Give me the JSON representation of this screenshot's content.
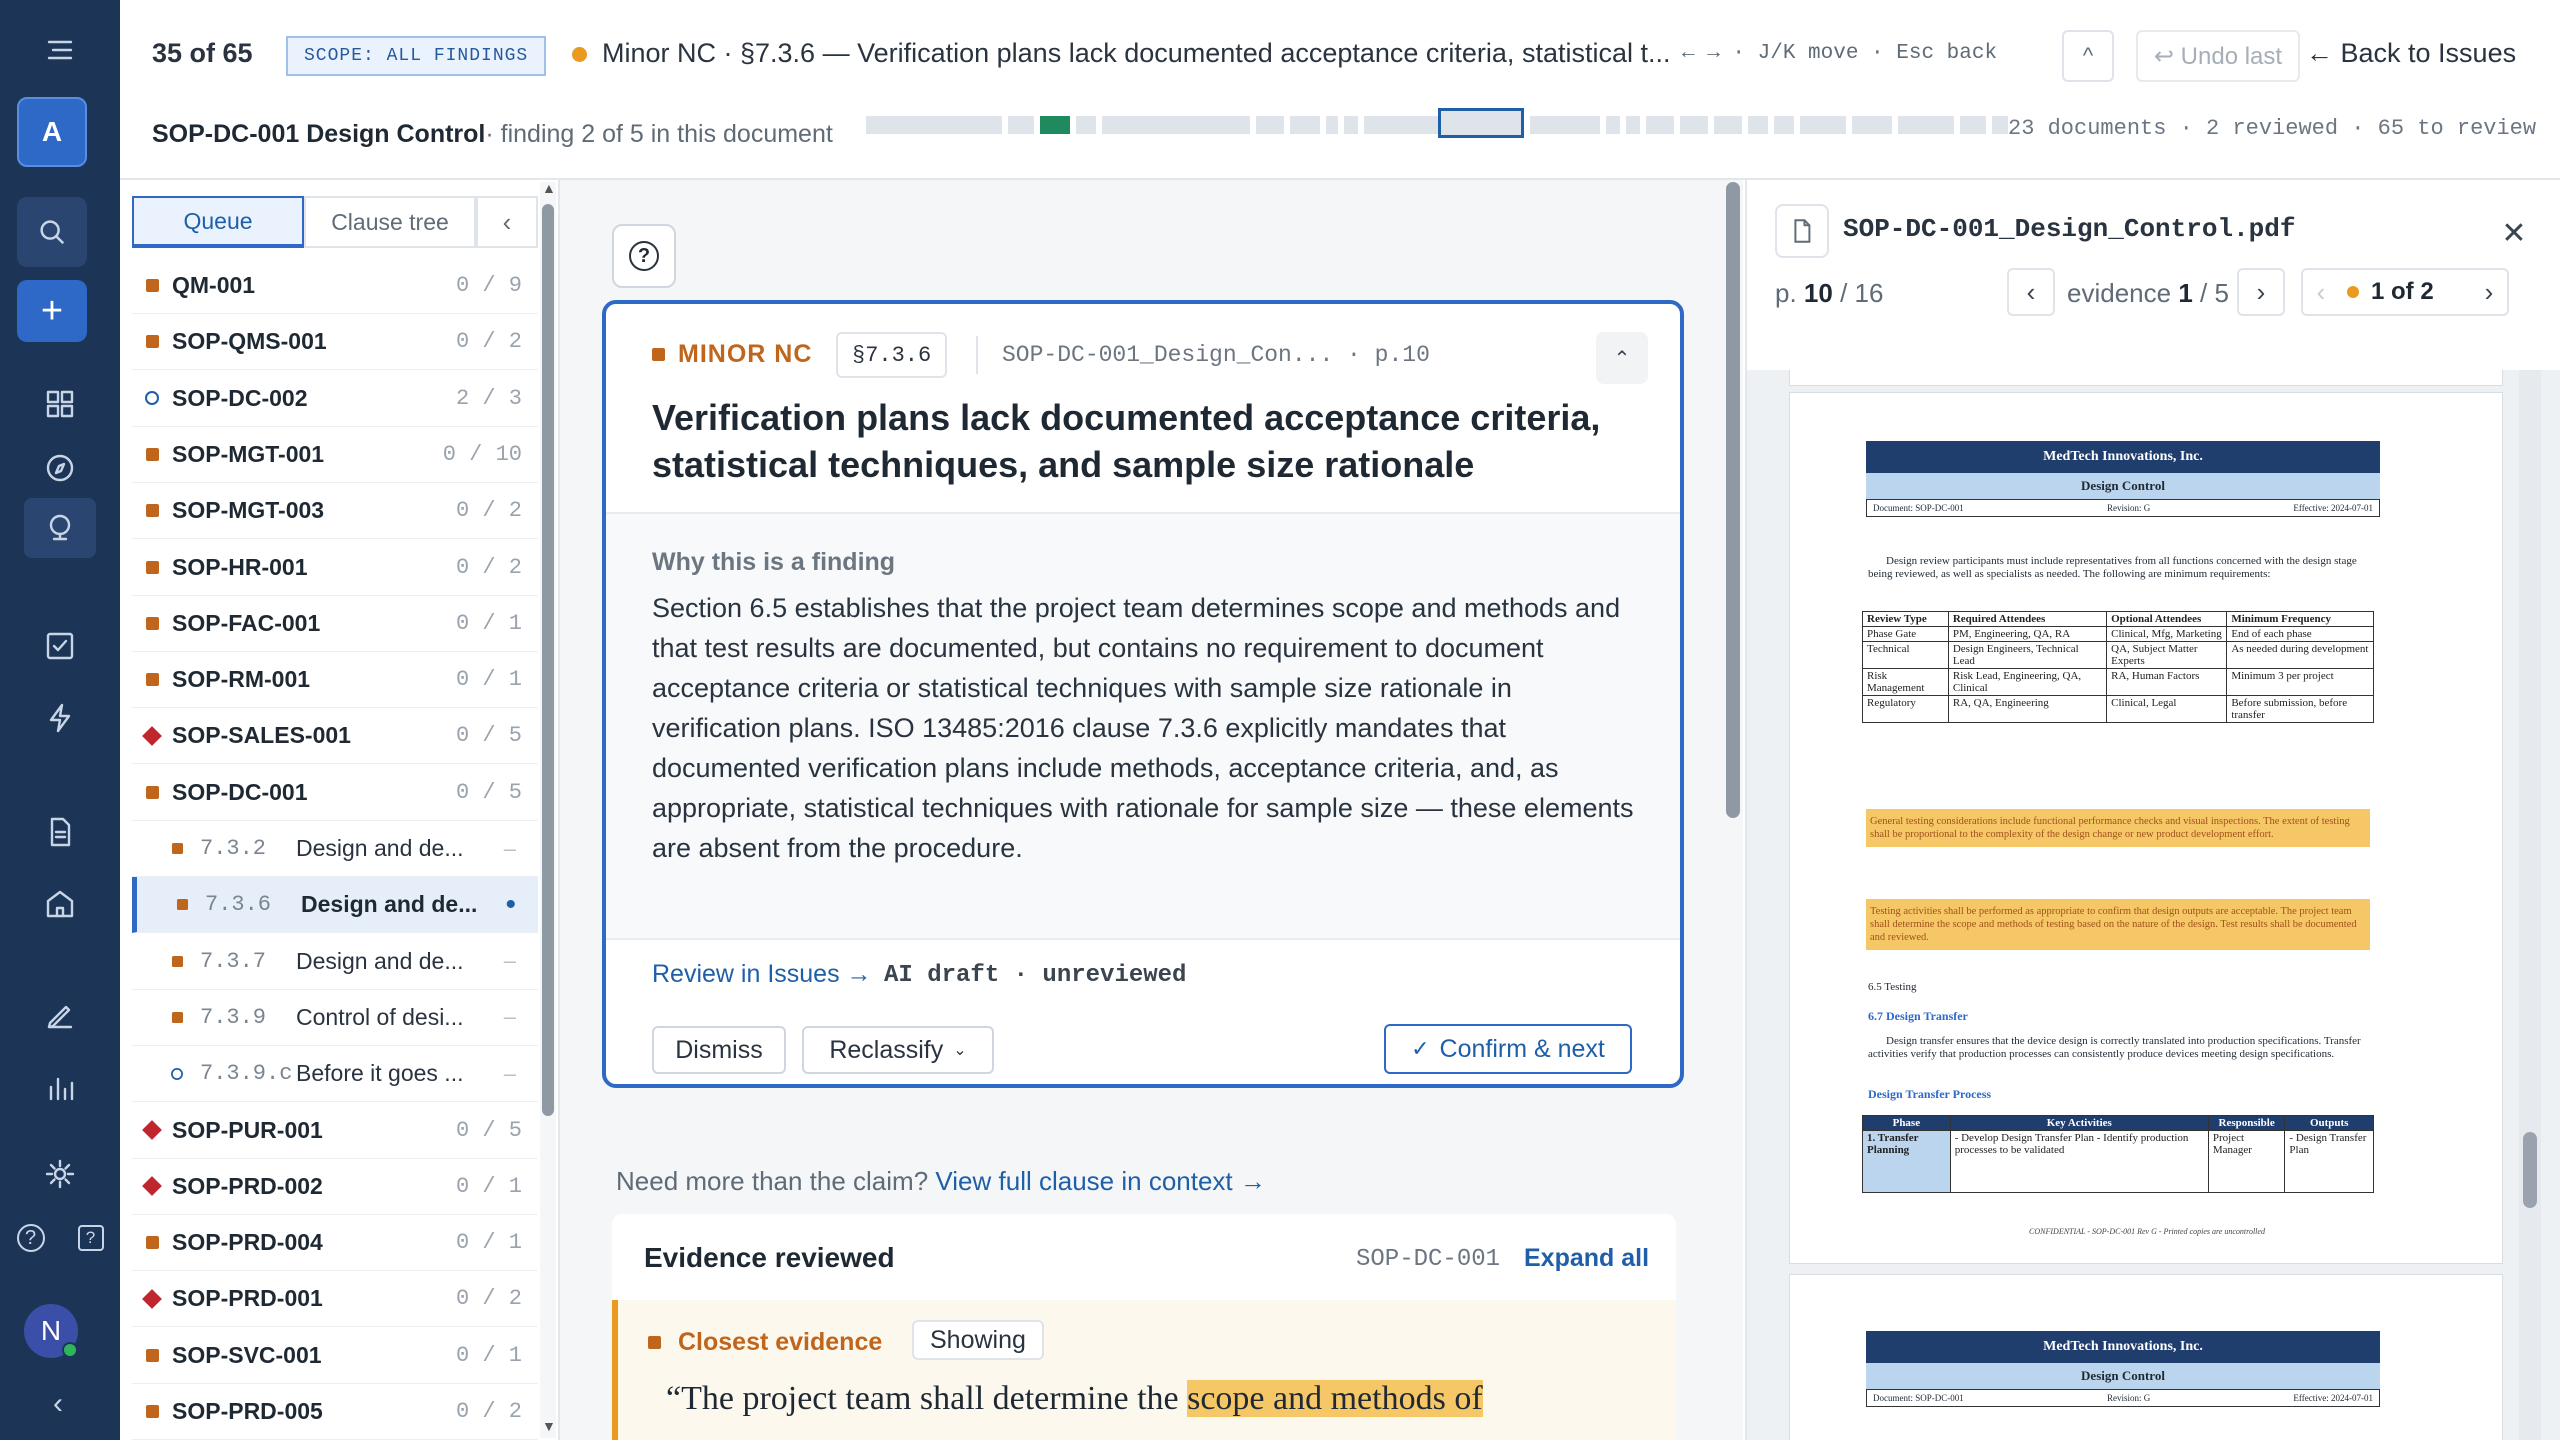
{
  "topbar": {
    "counter": "35 of 65",
    "scope": "SCOPE: ALL FINDINGS",
    "title": "Minor NC · §7.3.6 — Verification plans lack documented acceptance criteria, statistical t...",
    "shortcuts": "← → · J/K move · Esc back",
    "undo": "↩ Undo last",
    "back": "← Back to Issues",
    "doc_name": "SOP-DC-001 Design Control",
    "doc_sub": "· finding 2 of 5 in this document",
    "stats": "23 documents · 2 reviewed · 65 to review",
    "caret": "^"
  },
  "rail": {
    "workspace": "A",
    "avatar": "N",
    "help": "?"
  },
  "queue": {
    "tab_queue": "Queue",
    "tab_tree": "Clause tree",
    "collapse": "‹",
    "items": [
      {
        "name": "QM-001",
        "count": "0 / 9",
        "marker": "sq"
      },
      {
        "name": "SOP-QMS-001",
        "count": "0 / 2",
        "marker": "sq"
      },
      {
        "name": "SOP-DC-002",
        "count": "2 / 3",
        "marker": "circ"
      },
      {
        "name": "SOP-MGT-001",
        "count": "0 / 10",
        "marker": "sq"
      },
      {
        "name": "SOP-MGT-003",
        "count": "0 / 2",
        "marker": "sq"
      },
      {
        "name": "SOP-HR-001",
        "count": "0 / 2",
        "marker": "sq"
      },
      {
        "name": "SOP-FAC-001",
        "count": "0 / 1",
        "marker": "sq"
      },
      {
        "name": "SOP-RM-001",
        "count": "0 / 1",
        "marker": "sq"
      },
      {
        "name": "SOP-SALES-001",
        "count": "0 / 5",
        "marker": "dia"
      },
      {
        "name": "SOP-DC-001",
        "count": "0 / 5",
        "marker": "sq"
      }
    ],
    "sub": [
      {
        "clause": "7.3.2",
        "title": "Design and de...",
        "state": "–"
      },
      {
        "clause": "7.3.6",
        "title": "Design and de...",
        "state": "•"
      },
      {
        "clause": "7.3.7",
        "title": "Design and de...",
        "state": "–"
      },
      {
        "clause": "7.3.9",
        "title": "Control of desi...",
        "state": "–"
      },
      {
        "clause": "7.3.9.c",
        "title": "Before it goes ...",
        "state": "–"
      }
    ],
    "items2": [
      {
        "name": "SOP-PUR-001",
        "count": "0 / 5",
        "marker": "dia"
      },
      {
        "name": "SOP-PRD-002",
        "count": "0 / 1",
        "marker": "dia"
      },
      {
        "name": "SOP-PRD-004",
        "count": "0 / 1",
        "marker": "sq"
      },
      {
        "name": "SOP-PRD-001",
        "count": "0 / 2",
        "marker": "dia"
      },
      {
        "name": "SOP-SVC-001",
        "count": "0 / 1",
        "marker": "sq"
      },
      {
        "name": "SOP-PRD-005",
        "count": "0 / 2",
        "marker": "sq"
      }
    ]
  },
  "finding": {
    "severity": "MINOR NC",
    "clause": "§7.3.6",
    "source": "SOP-DC-001_Design_Con... · p.10",
    "title": "Verification plans lack documented acceptance criteria, statistical techniques, and sample size rationale",
    "why_label": "Why this is a finding",
    "why_text": "Section 6.5 establishes that the project team determines scope and methods and that test results are documented, but contains no requirement to document acceptance criteria or statistical techniques with sample size rationale in verification plans. ISO 13485:2016 clause 7.3.6 explicitly mandates that documented verification plans include methods, acceptance criteria, and, as appropriate, statistical techniques with rationale for sample size — these elements are absent from the procedure.",
    "review_link": "Review in Issues →",
    "ai_status": "AI draft · unreviewed",
    "dismiss": "Dismiss",
    "reclassify": "Reclassify",
    "confirm": "Confirm & next",
    "help": "?"
  },
  "context": {
    "prompt": "Need more than the claim?",
    "link": "View full clause in context →"
  },
  "evidence": {
    "header": "Evidence reviewed",
    "doc": "SOP-DC-001",
    "expand": "Expand all",
    "closest": "Closest evidence",
    "showing": "Showing",
    "quote_pre": "“The project team shall determine the ",
    "quote_hl": "scope and methods of"
  },
  "pdf": {
    "filename": "SOP-DC-001_Design_Control.pdf",
    "page_cur": "10",
    "page_total": "/ 16",
    "page_prefix": "p.",
    "ev_label": "evidence",
    "ev_cur": "1",
    "ev_total": "/ 5",
    "hit": "1 of 2",
    "doc": {
      "company": "MedTech Innovations, Inc.",
      "section": "Design Control",
      "docno": "Document: SOP-DC-001",
      "rev": "Revision: G",
      "eff": "Effective: 2024-07-01",
      "p1": "Design review participants must include representatives from all functions concerned with the design stage being reviewed, as well as specialists as needed. The following are minimum requirements:",
      "th": [
        "Review Type",
        "Required Attendees",
        "Optional Attendees",
        "Minimum Frequency"
      ],
      "rows": [
        [
          "Phase Gate",
          "PM, Engineering, QA, RA",
          "Clinical, Mfg, Marketing",
          "End of each phase"
        ],
        [
          "Technical",
          "Design Engineers, Technical Lead",
          "QA, Subject Matter Experts",
          "As needed during development"
        ],
        [
          "Risk Management",
          "Risk Lead, Engineering, QA, Clinical",
          "RA, Human Factors",
          "Minimum 3 per project"
        ],
        [
          "Regulatory",
          "RA, QA, Engineering",
          "Clinical, Legal",
          "Before submission, before transfer"
        ]
      ],
      "hl1": "General testing considerations include functional performance checks and visual inspections. The extent of testing shall be proportional to the complexity of the design change or new product development effort.",
      "hl2": "Testing activities shall be performed as appropriate to confirm that design outputs are acceptable. The project team shall determine the scope and methods of testing based on the nature of the design. Test results shall be documented and reviewed.",
      "h65": "6.5 Testing",
      "h67": "6.7 Design Transfer",
      "p2": "Design transfer ensures that the device design is correctly translated into production specifications. Transfer activities verify that production processes can consistently produce devices meeting design specifications.",
      "dtp": "Design Transfer Process",
      "th2": [
        "Phase",
        "Key Activities",
        "Responsible",
        "Outputs"
      ],
      "row2": [
        "1. Transfer Planning",
        "- Develop Design Transfer Plan - Identify production processes to be validated",
        "Project Manager",
        "- Design Transfer Plan"
      ],
      "footer": "CONFIDENTIAL - SOP-DC-001 Rev G - Printed copies are uncontrolled"
    }
  }
}
